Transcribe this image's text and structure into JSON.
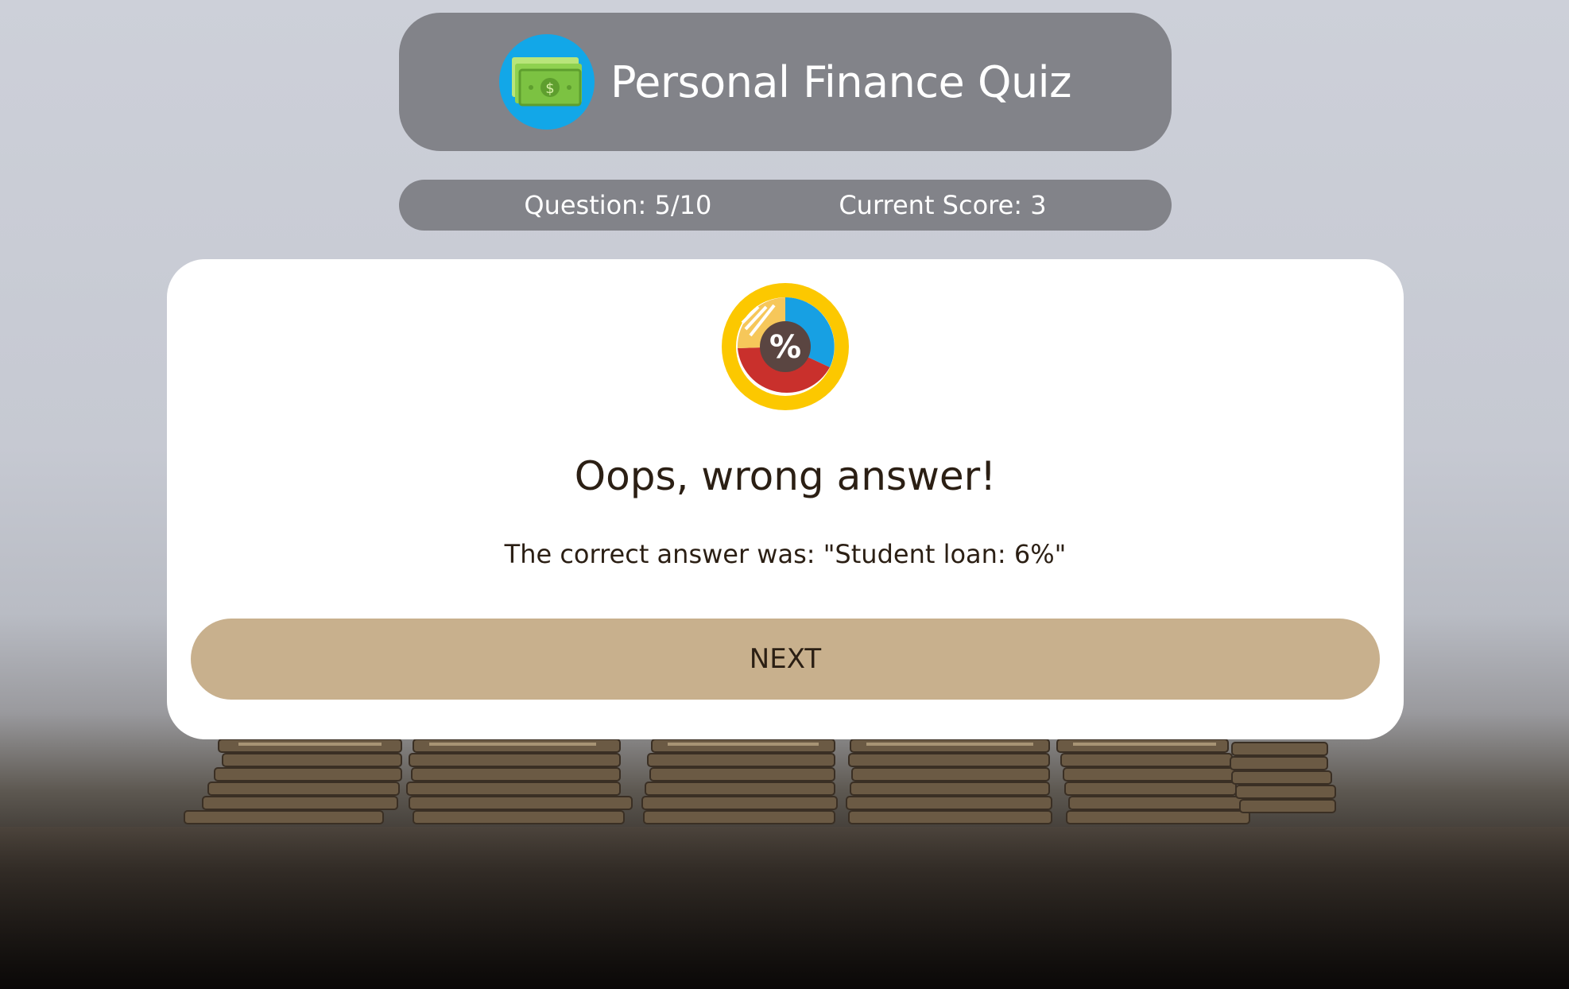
{
  "header": {
    "title": "Personal Finance Quiz",
    "logo_icon": "money-bills-icon"
  },
  "status": {
    "question": "Question: 5/10",
    "score": "Current Score: 3"
  },
  "card": {
    "icon": "percent-pie-chart-icon",
    "heading": "Oops, wrong answer!",
    "detail": "The correct answer was: \"Student loan: 6%\"",
    "next_label": "NEXT"
  },
  "colors": {
    "pill": "#828389",
    "logo_bg": "#12a7e8",
    "button": "#c8b08d",
    "text_dark": "#2b1f14"
  }
}
